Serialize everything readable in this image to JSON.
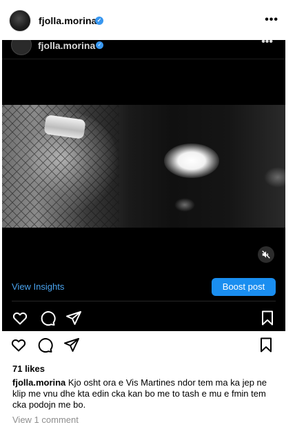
{
  "post": {
    "username": "fjolla.morina",
    "more_label": "•••"
  },
  "embedded": {
    "username": "fjolla.morina",
    "more_label": "•••",
    "view_insights_label": "View Insights",
    "boost_post_label": "Boost post"
  },
  "engagement": {
    "likes": "71 likes",
    "caption_user": "fjolla.morina",
    "caption_text": "Kjo osht ora e Vis Martines ndor tem ma ka jep ne klip me vnu dhe kta edin cka kan bo me to tash e mu e fmin tem cka podojn me bo.",
    "comments_link": "View 1 comment"
  },
  "icons": [
    "heart-icon",
    "comment-icon",
    "share-icon",
    "bookmark-icon",
    "mute-icon",
    "verified-badge-icon"
  ],
  "colors": {
    "accent": "#3897f0",
    "boost": "#1a8ef0",
    "link_dark": "#4aa3ee",
    "muted": "#8e8e8e"
  }
}
